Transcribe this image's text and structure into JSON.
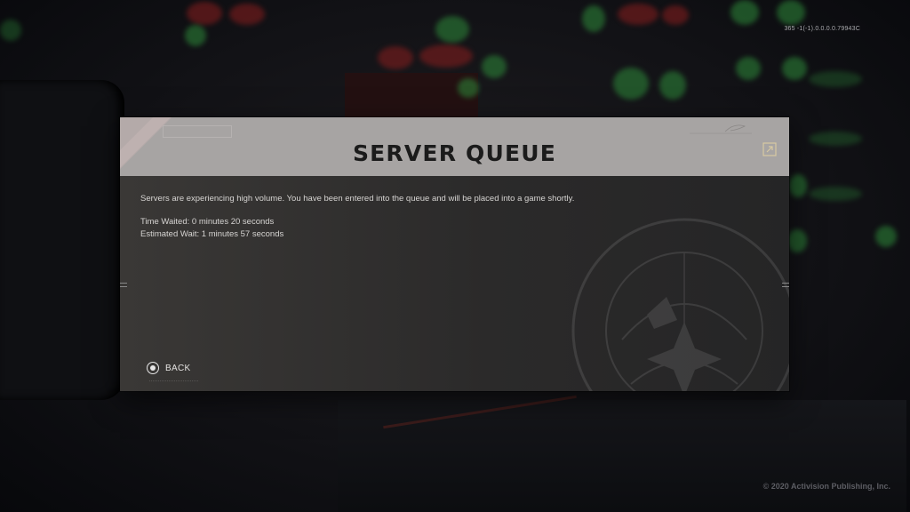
{
  "build_id": "365 -1(-1).0.0.0.0.79943C",
  "copyright": "© 2020 Activision Publishing, Inc.",
  "dialog": {
    "title": "SERVER QUEUE",
    "message": "Servers are experiencing high volume. You have been entered into the queue and will be placed into a game shortly.",
    "time_waited": "Time Waited: 0 minutes 20 seconds",
    "estimated_wait": "Estimated Wait: 1 minutes 57 seconds",
    "back_label": "BACK"
  },
  "icons": {
    "expand": "expand-icon",
    "back_button": "circle-button-icon",
    "emblem": "agency-seal-emblem"
  },
  "colors": {
    "header_bg": "#a7a4a3",
    "panel_bg": "#2b2a2a",
    "title_text": "#1b1b1b",
    "body_text": "#d6d4d2"
  }
}
